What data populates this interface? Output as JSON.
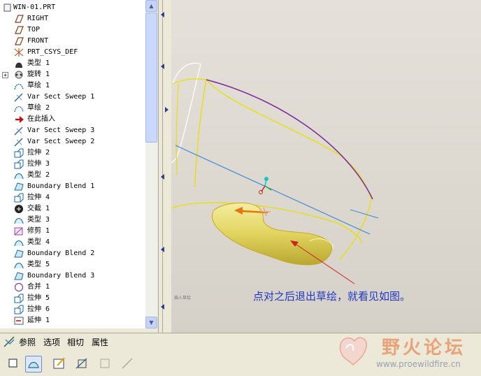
{
  "model_tree": {
    "items": [
      {
        "label": "WIN-01.PRT",
        "icon": "part-icon"
      },
      {
        "label": "RIGHT",
        "icon": "datum-plane-icon"
      },
      {
        "label": "TOP",
        "icon": "datum-plane-icon"
      },
      {
        "label": "FRONT",
        "icon": "datum-plane-icon"
      },
      {
        "label": "PRT_CSYS_DEF",
        "icon": "csys-icon"
      },
      {
        "label": "类型 1",
        "icon": "type-feature-icon"
      },
      {
        "label": "旋转 1",
        "icon": "revolve-icon",
        "expand": "+"
      },
      {
        "label": "草绘 1",
        "icon": "sketch-icon"
      },
      {
        "label": "Var Sect Sweep 1",
        "icon": "var-sweep-icon"
      },
      {
        "label": "草绘 2",
        "icon": "sketch-icon"
      },
      {
        "label": "在此插入",
        "icon": "insert-here-arrow-icon"
      },
      {
        "label": "Var Sect Sweep 3",
        "icon": "var-sweep-icon"
      },
      {
        "label": "Var Sect Sweep 2",
        "icon": "var-sweep-icon"
      },
      {
        "label": "拉伸 2",
        "icon": "extrude-icon"
      },
      {
        "label": "拉伸 3",
        "icon": "extrude-icon"
      },
      {
        "label": "类型 2",
        "icon": "surface-type-icon"
      },
      {
        "label": "Boundary Blend 1",
        "icon": "boundary-blend-icon"
      },
      {
        "label": "拉伸 4",
        "icon": "extrude-icon"
      },
      {
        "label": "交截 1",
        "icon": "intersect-icon"
      },
      {
        "label": "类型 3",
        "icon": "surface-type-icon"
      },
      {
        "label": "修剪 1",
        "icon": "trim-icon"
      },
      {
        "label": "类型 4",
        "icon": "surface-type-icon"
      },
      {
        "label": "Boundary Blend 2",
        "icon": "boundary-blend-icon"
      },
      {
        "label": "类型 5",
        "icon": "surface-type-icon"
      },
      {
        "label": "Boundary Blend 3",
        "icon": "boundary-blend-icon"
      },
      {
        "label": "合并 1",
        "icon": "merge-icon"
      },
      {
        "label": "拉伸 5",
        "icon": "extrude-icon"
      },
      {
        "label": "拉伸 6",
        "icon": "extrude-icon"
      },
      {
        "label": "延伸 1",
        "icon": "extend-icon"
      }
    ]
  },
  "dashboard": {
    "menu": [
      "参照",
      "选项",
      "相切",
      "属性"
    ],
    "tools": [
      "solid-icon",
      "surface-icon",
      "edit-sketch-icon",
      "trajectory-icon",
      "box-icon",
      "slash-icon"
    ]
  },
  "viewport": {
    "annotation": "点对之后退出草绘，就看见如图。",
    "tiny_label": "插入草绘"
  },
  "watermark": {
    "text": "野火论坛",
    "url": "www.proewildfire.cn"
  },
  "colors": {
    "annotation": "#1f36c8",
    "curve_yellow": "#e8e000",
    "curve_purple": "#7a2aa0",
    "axis_blue": "#3a8ad8",
    "surface": "#e6d96a",
    "arrow_red": "#d02020"
  }
}
